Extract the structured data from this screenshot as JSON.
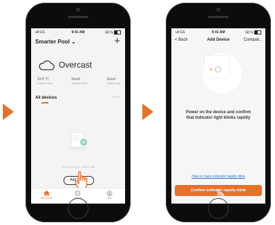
{
  "colors": {
    "accent": "#e8712a",
    "link": "#2f6fd6"
  },
  "screen1": {
    "status": {
      "carrier": "ull GS",
      "time": "9:41 AM",
      "battery": "58 %"
    },
    "home_name": "Smarter Pool",
    "add_icon": "plus-icon",
    "weather": {
      "icon": "cloud-icon",
      "condition": "Overcast"
    },
    "metrics": [
      {
        "value": "23.0 °C",
        "label": "Outdoor Temp"
      },
      {
        "value": "Good",
        "label": "Outdoor PM2.5"
      },
      {
        "value": "Good",
        "label": "Outdoor AQI"
      }
    ],
    "section_title": "All devices",
    "more_label": "···",
    "empty_text": "No devices yet, please add",
    "add_device_label": "Add Device",
    "tabs": [
      {
        "label": "My Home",
        "icon": "home-icon"
      },
      {
        "label": "Smart",
        "icon": "smart-icon"
      },
      {
        "label": "Me",
        "icon": "user-icon"
      }
    ]
  },
  "screen2": {
    "status": {
      "carrier": "ull GS",
      "time": "9:41 AM",
      "battery": "58 %"
    },
    "back_label": "< Back",
    "title": "Add Device",
    "compat_label": "Compati...",
    "instruction_line1": "Power on the device and confirm",
    "instruction_line2": "that indicator light blinks rapidly",
    "help_link": "How to make indicator rapidly blink",
    "confirm_label": "Confirm indicator rapidly blink"
  }
}
